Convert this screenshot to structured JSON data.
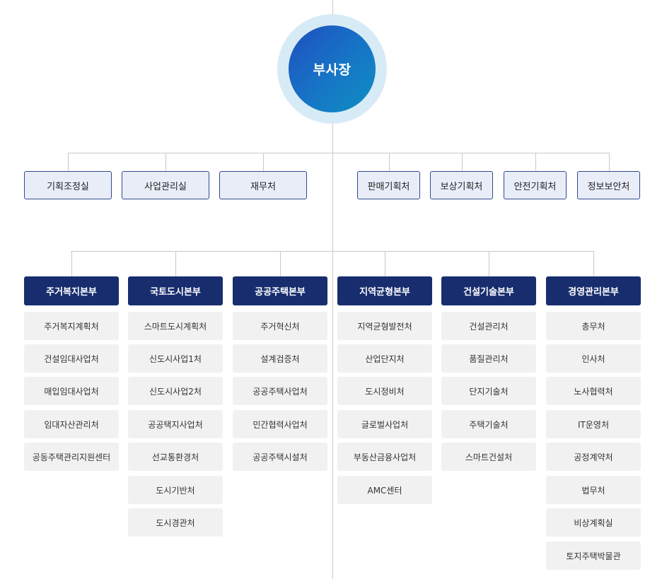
{
  "root": {
    "label": "부사장"
  },
  "staff_left": [
    "기획조정실",
    "사업관리실",
    "재무처"
  ],
  "staff_right": [
    "판매기획처",
    "보상기획처",
    "안전기획처",
    "정보보안처"
  ],
  "divisions": [
    {
      "name": "주거복지본부",
      "units": [
        "주거복지계획처",
        "건설임대사업처",
        "매입임대사업처",
        "임대자산관리처",
        "공동주택관리지원센터"
      ]
    },
    {
      "name": "국토도시본부",
      "units": [
        "스마트도시계획처",
        "신도시사업1처",
        "신도시사업2처",
        "공공택지사업처",
        "선교통환경처",
        "도시기반처",
        "도시경관처"
      ]
    },
    {
      "name": "공공주택본부",
      "units": [
        "주거혁신처",
        "설계검증처",
        "공공주택사업처",
        "민간협력사업처",
        "공공주택시설처"
      ]
    },
    {
      "name": "지역균형본부",
      "units": [
        "지역균형발전처",
        "산업단지처",
        "도시정비처",
        "글로벌사업처",
        "부동산금융사업처",
        "AMC센터"
      ]
    },
    {
      "name": "건설기술본부",
      "units": [
        "건설관리처",
        "품질관리처",
        "단지기술처",
        "주택기술처",
        "스마트건설처"
      ]
    },
    {
      "name": "경영관리본부",
      "units": [
        "총무처",
        "인사처",
        "노사협력처",
        "IT운영처",
        "공정계약처",
        "법무처",
        "비상계획실",
        "토지주택박물관"
      ]
    }
  ]
}
